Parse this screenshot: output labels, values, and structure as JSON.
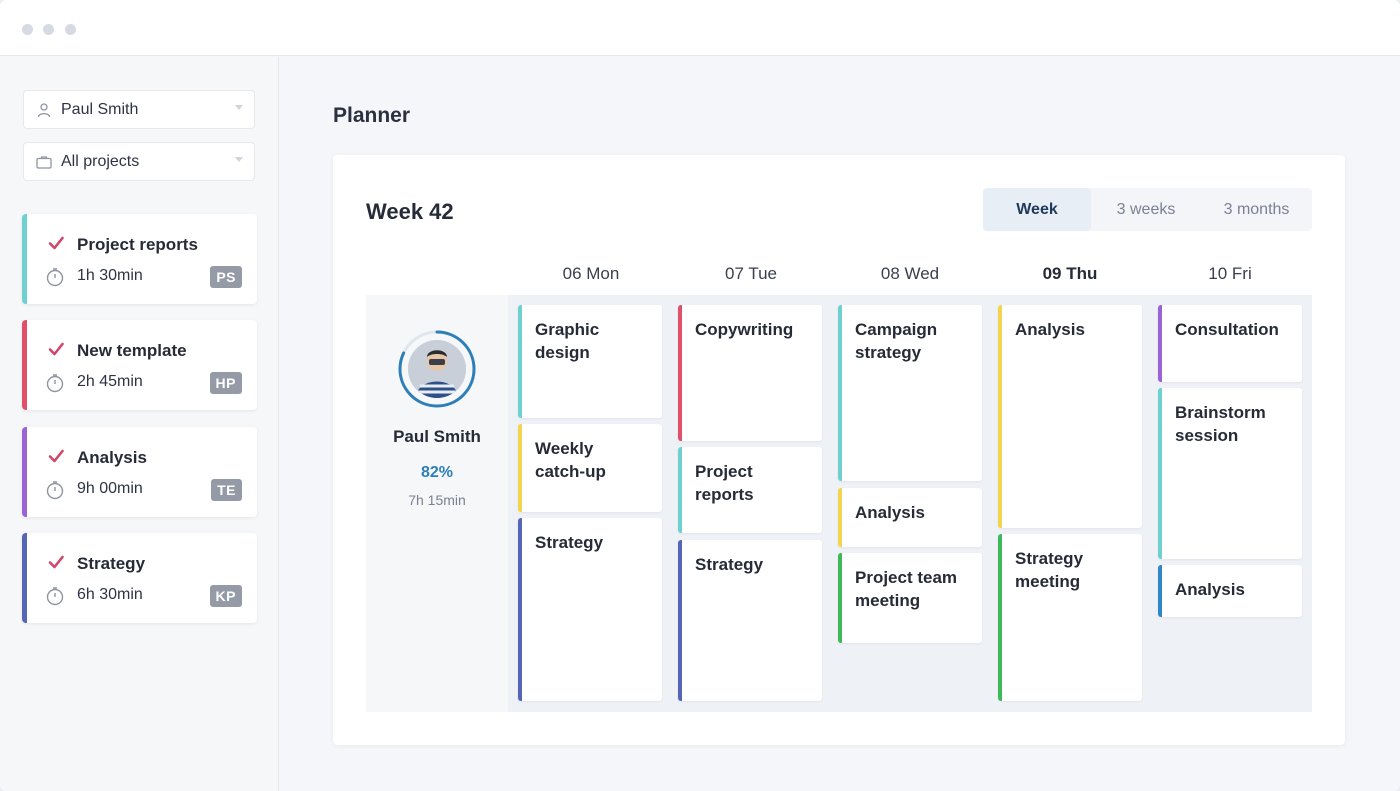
{
  "colors": {
    "teal": "#6fd1cf",
    "red": "#e0506a",
    "purple": "#9a63d8",
    "navy": "#5565b7",
    "yellow": "#f2d44e",
    "green": "#3fb85a",
    "blue": "#2f86c9",
    "accent": "#2e7fb8"
  },
  "sidebar": {
    "filters": [
      {
        "label": "Paul Smith",
        "icon": "user-icon"
      },
      {
        "label": "All projects",
        "icon": "briefcase-icon"
      }
    ],
    "tasks": [
      {
        "name": "Project reports",
        "time": "1h 30min",
        "badge": "PS",
        "color": "teal"
      },
      {
        "name": "New template",
        "time": "2h 45min",
        "badge": "HP",
        "color": "red"
      },
      {
        "name": "Analysis",
        "time": "9h 00min",
        "badge": "TE",
        "color": "purple"
      },
      {
        "name": "Strategy",
        "time": "6h 30min",
        "badge": "KP",
        "color": "navy"
      }
    ]
  },
  "page": {
    "title": "Planner"
  },
  "planner": {
    "week_title": "Week 42",
    "views": [
      "Week",
      "3 weeks",
      "3 months"
    ],
    "active_view": "Week",
    "days": [
      "06 Mon",
      "07 Tue",
      "08 Wed",
      "09 Thu",
      "10 Fri"
    ],
    "today": "09 Thu",
    "person": {
      "name": "Paul Smith",
      "utilization": "82%",
      "utilization_value": 0.82,
      "hours": "7h 15min"
    },
    "events": [
      [
        {
          "title": "Graphic\ndesign",
          "color": "teal"
        },
        {
          "title": "Weekly\ncatch-up",
          "color": "yellow"
        },
        {
          "title": "Strategy",
          "color": "navy"
        }
      ],
      [
        {
          "title": "Copywriting",
          "color": "red"
        },
        {
          "title": "Project\nreports",
          "color": "teal"
        },
        {
          "title": "Strategy",
          "color": "navy"
        }
      ],
      [
        {
          "title": "Campaign\nstrategy",
          "color": "teal"
        },
        {
          "title": "Analysis",
          "color": "yellow"
        },
        {
          "title": "Project team\nmeeting",
          "color": "green"
        }
      ],
      [
        {
          "title": "Analysis",
          "color": "yellow"
        },
        {
          "title": "Strategy\nmeeting",
          "color": "green"
        }
      ],
      [
        {
          "title": "Consultation",
          "color": "purple"
        },
        {
          "title": "Brainstorm\nsession",
          "color": "teal"
        },
        {
          "title": "Analysis",
          "color": "blue"
        }
      ]
    ]
  }
}
